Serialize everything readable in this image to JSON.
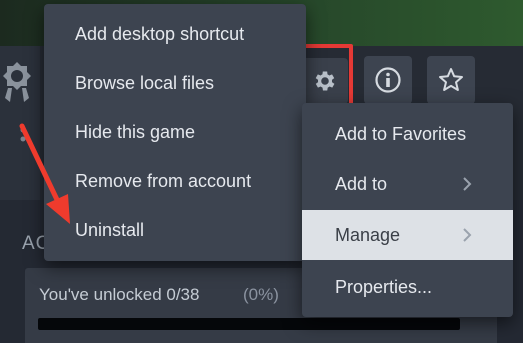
{
  "menu_left": {
    "items": [
      "Add desktop shortcut",
      "Browse local files",
      "Hide this game",
      "Remove from account",
      "Uninstall"
    ]
  },
  "menu_right": {
    "items": [
      {
        "label": "Add to Favorites",
        "has_submenu": false,
        "active": false
      },
      {
        "label": "Add to",
        "has_submenu": true,
        "active": false
      },
      {
        "label": "Manage",
        "has_submenu": true,
        "active": true
      },
      {
        "label": "Properties...",
        "has_submenu": false,
        "active": false
      }
    ]
  },
  "toolbar": {
    "buttons": [
      "gear-icon",
      "info-icon",
      "star-icon"
    ]
  },
  "achievements": {
    "heading": "AC",
    "unlocked_text": "You've unlocked 0/38",
    "unlocked_pct": "(0%)",
    "progress_fraction": 0
  },
  "colors": {
    "menu_bg": "#3d4450",
    "highlight_red": "#e53935",
    "active_item_bg": "#dde1e6"
  }
}
